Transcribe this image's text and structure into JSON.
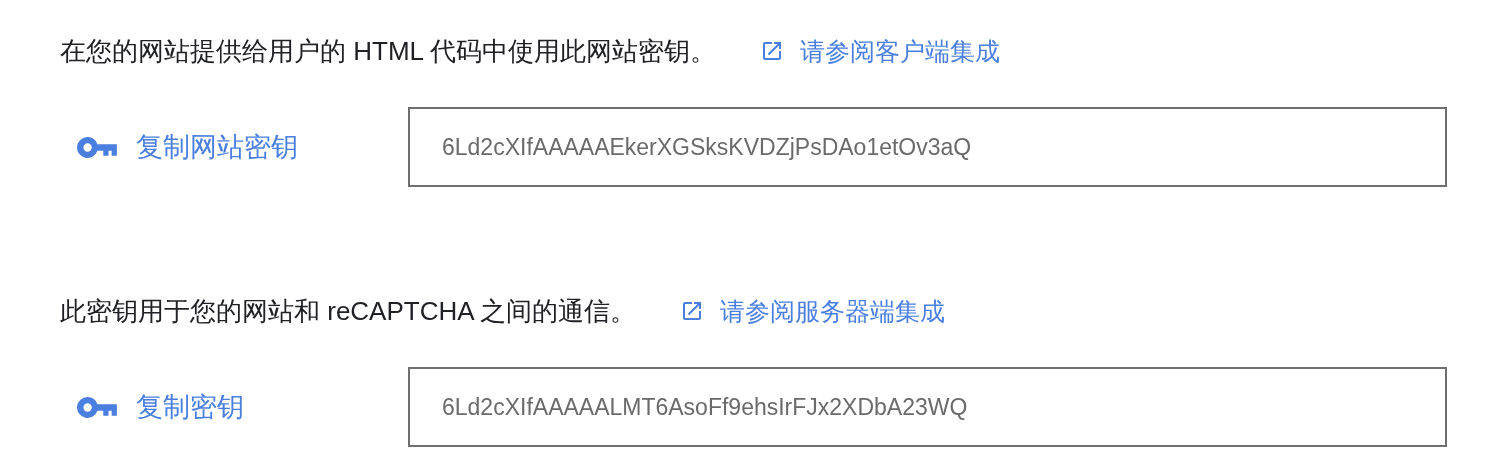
{
  "sections": [
    {
      "description": "在您的网站提供给用户的 HTML 代码中使用此网站密钥。",
      "link": "请参阅客户端集成",
      "copy_button": "复制网站密钥",
      "key_field": {
        "value": "6Ld2cXIfAAAAAEkerXGSksKVDZjPsDAo1etOv3aQ"
      }
    },
    {
      "description": "此密钥用于您的网站和 reCAPTCHA 之间的通信。",
      "link": "请参阅服务器端集成",
      "copy_button": "复制密钥",
      "key_field": {
        "value": "6Ld2cXIfAAAAALMT6AsoFf9ehsIrFJx2XDbA23WQ"
      }
    }
  ]
}
